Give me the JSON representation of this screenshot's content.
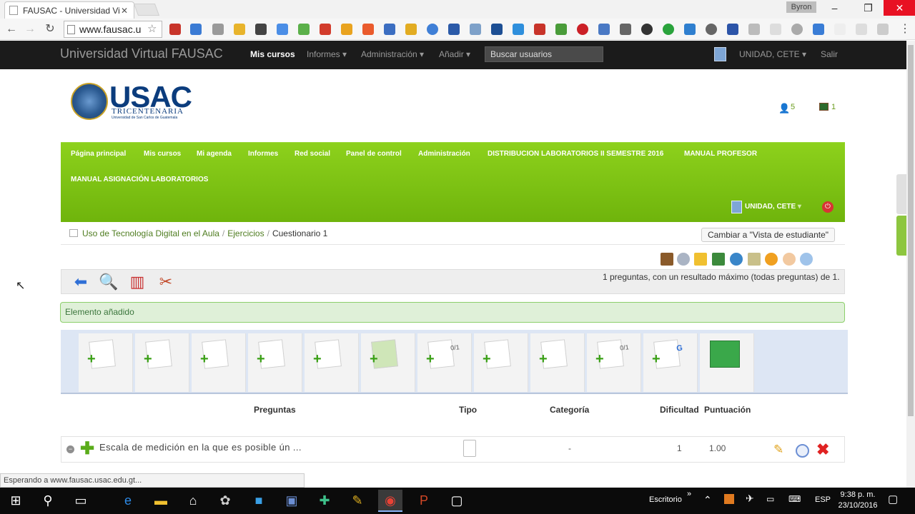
{
  "browser": {
    "tab_title": "FAUSAC - Universidad Virt",
    "url": "www.fausac.u",
    "window_user": "Byron",
    "status": "Esperando a www.fausac.usac.edu.gt..."
  },
  "topnav": {
    "brand": "Universidad Virtual FAUSAC",
    "items": [
      "Mis cursos",
      "Informes",
      "Administración",
      "Añadir"
    ],
    "search_placeholder": "Buscar usuarios",
    "user": "UNIDAD, CETE",
    "logout": "Salir"
  },
  "header": {
    "logo_main": "USAC",
    "logo_sub": "TRICENTENARIA",
    "logo_tiny": "Universidad de San Carlos de Guatemala",
    "messages_count": "5",
    "notifications_count": "1"
  },
  "greenmenu": {
    "row1": [
      "Página principal",
      "Mis cursos",
      "Mi agenda",
      "Informes",
      "Red social",
      "Panel de control",
      "Administración",
      "DISTRIBUCION LABORATORIOS II SEMESTRE 2016",
      "MANUAL PROFESOR"
    ],
    "row2": [
      "MANUAL ASIGNACIÓN LABORATORIOS"
    ],
    "user": "UNIDAD, CETE"
  },
  "breadcrumb": {
    "course": "Uso de Tecnología Digital en el Aula",
    "section": "Ejercicios",
    "current": "Cuestionario 1"
  },
  "student_view_button": "Cambiar a \"Vista de estudiante\"",
  "quiz_summary": "1 preguntas, con un resultado máximo (todas preguntas) de 1.",
  "alert": "Elemento añadido",
  "question_types": [
    "",
    "",
    "",
    "",
    "",
    "",
    "0/1",
    "",
    "",
    "0/1",
    "G",
    ""
  ],
  "table": {
    "headers": {
      "preguntas": "Preguntas",
      "tipo": "Tipo",
      "categoria": "Categoría",
      "dificultad": "Dificultad",
      "puntuacion": "Puntuación"
    },
    "rows": [
      {
        "text": "Escala de medición en la que es posible ún ...",
        "categoria": "-",
        "dificultad": "1",
        "puntuacion": "1.00"
      }
    ]
  },
  "taskbar": {
    "desktop": "Escritorio",
    "lang": "ESP",
    "time": "9:38 p. m.",
    "date": "23/10/2016"
  },
  "colors": {
    "green_menu": "#7cc414",
    "topnav": "#1b1b1b",
    "alert_bg": "#dff0d8",
    "link": "#4e7c1f"
  }
}
